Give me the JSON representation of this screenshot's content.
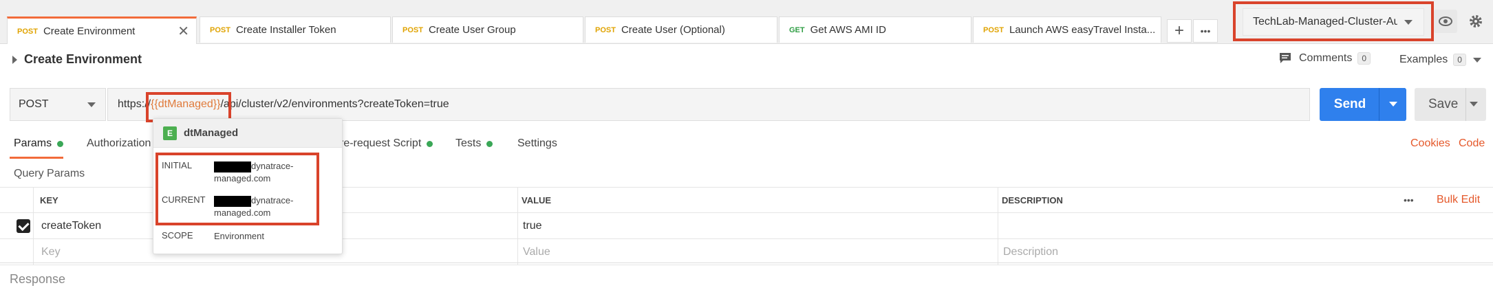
{
  "tabs": [
    {
      "method": "POST",
      "name": "Create Environment",
      "active": true
    },
    {
      "method": "POST",
      "name": "Create Installer Token"
    },
    {
      "method": "POST",
      "name": "Create User Group"
    },
    {
      "method": "POST",
      "name": "Create User (Optional)"
    },
    {
      "method": "GET",
      "name": "Get AWS AMI ID"
    },
    {
      "method": "POST",
      "name": "Launch AWS easyTravel Insta..."
    }
  ],
  "tab_controls": {
    "add": "+",
    "more": "•••",
    "close": "✕"
  },
  "environment": {
    "selected": "TechLab-Managed-Cluster-Au"
  },
  "request": {
    "title": "Create Environment",
    "comments_label": "Comments",
    "comments_count": "0",
    "examples_label": "Examples",
    "examples_count": "0",
    "method": "POST",
    "url_prefix": "https://",
    "url_var": "{{dtManaged}}",
    "url_suffix": "/api/cluster/v2/environments?createToken=true",
    "send_label": "Send",
    "save_label": "Save"
  },
  "subtabs": [
    {
      "label": "Params",
      "dot": true
    },
    {
      "label": "Authorization",
      "dot": false
    },
    {
      "label": "Pre-request Script",
      "dot": true,
      "visible_text": "re-request Script"
    },
    {
      "label": "Tests",
      "dot": true
    },
    {
      "label": "Settings",
      "dot": false
    }
  ],
  "right_links": {
    "cookies": "Cookies",
    "code": "Code"
  },
  "query_params": {
    "section_label": "Query Params",
    "headers": {
      "key": "KEY",
      "value": "VALUE",
      "description": "DESCRIPTION"
    },
    "more": "•••",
    "bulk_edit": "Bulk Edit",
    "rows": [
      {
        "checked": true,
        "key": "createToken",
        "value": "true",
        "description": ""
      }
    ],
    "placeholders": {
      "key": "Key",
      "value": "Value",
      "description": "Description"
    }
  },
  "response_label": "Response",
  "popover": {
    "badge": "E",
    "variable": "dtManaged",
    "initial_label": "INITIAL",
    "initial_value_suffix": "dynatrace-",
    "initial_value_line2": "managed.com",
    "current_label": "CURRENT",
    "current_value_suffix": "dynatrace-",
    "current_value_line2": "managed.com",
    "scope_label": "SCOPE",
    "scope_value": "Environment"
  },
  "colors": {
    "accent": "#f26b3a",
    "send": "#2f80ed",
    "highlight": "#d9432b",
    "variable": "#e07b3c",
    "post": "#e0a300",
    "get": "#2f9e44"
  }
}
